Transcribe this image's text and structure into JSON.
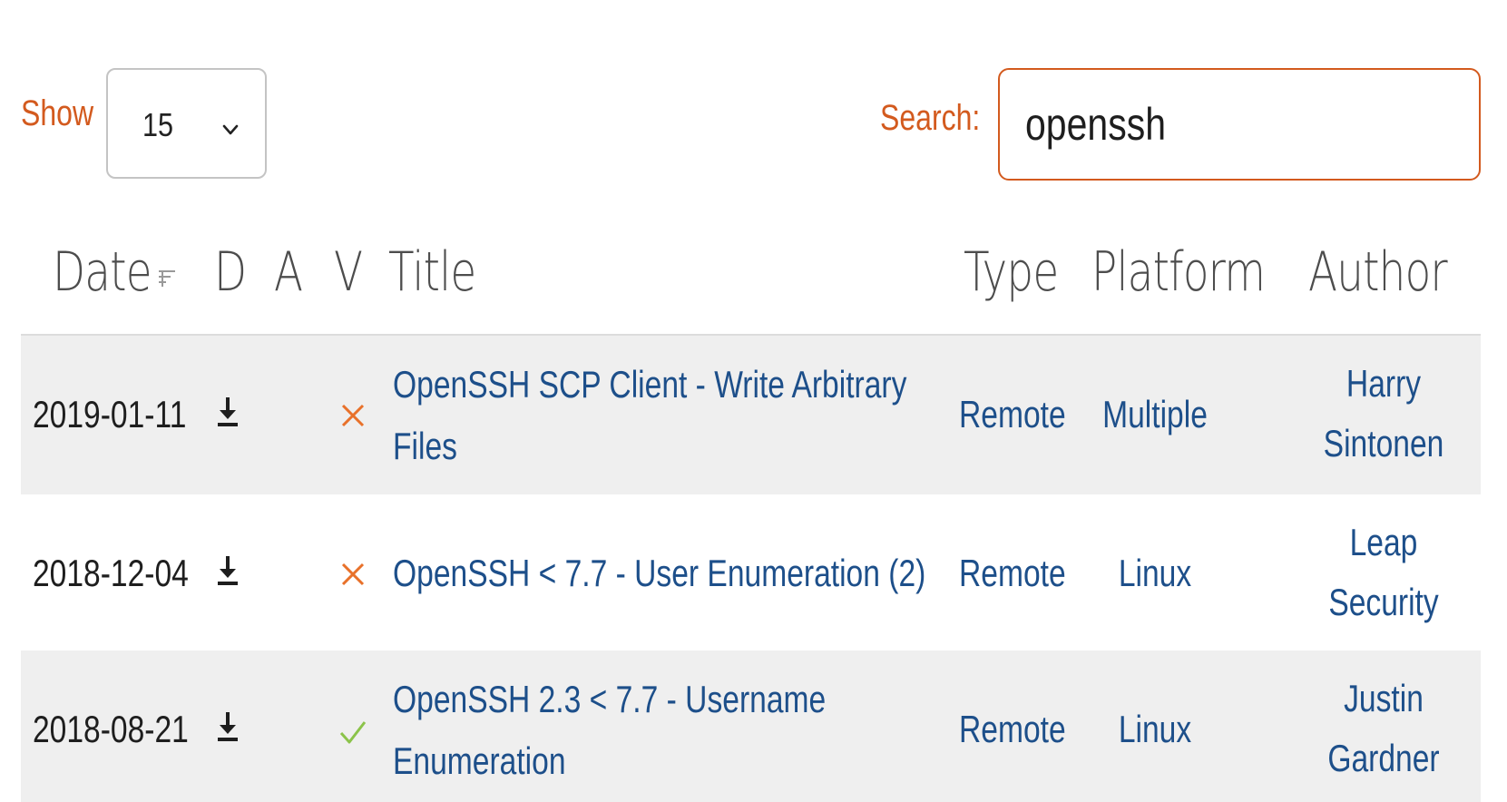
{
  "controls": {
    "show_label": "Show",
    "show_value": "15",
    "search_label": "Search:",
    "search_value": "openssh"
  },
  "columns": [
    "Date",
    "D",
    "A",
    "V",
    "Title",
    "Type",
    "Platform",
    "Author"
  ],
  "rows": [
    {
      "date": "2019-01-11",
      "verified": false,
      "title_lines": [
        "OpenSSH SCP Client - Write Arbitrary",
        "Files"
      ],
      "type": "Remote",
      "platform": "Multiple",
      "author_lines": [
        "Harry",
        "Sintonen"
      ]
    },
    {
      "date": "2018-12-04",
      "verified": false,
      "title_lines": [
        "OpenSSH < 7.7 - User Enumeration (2)"
      ],
      "type": "Remote",
      "platform": "Linux",
      "author_lines": [
        "Leap",
        "Security"
      ]
    },
    {
      "date": "2018-08-21",
      "verified": true,
      "title_lines": [
        "OpenSSH 2.3 < 7.7 - Username",
        "Enumeration"
      ],
      "type": "Remote",
      "platform": "Linux",
      "author_lines": [
        "Justin",
        "Gardner"
      ]
    }
  ],
  "colors": {
    "accent": "#d35a1e",
    "link": "#1d4f8a",
    "unverified": "#e8712a",
    "verified": "#8bc34a",
    "row_shade": "#efefef"
  },
  "icons": {
    "download": "download-icon",
    "unverified": "cross-icon",
    "verified": "check-icon",
    "sort": "sort-icon",
    "dropdown": "chevron-down-icon"
  }
}
